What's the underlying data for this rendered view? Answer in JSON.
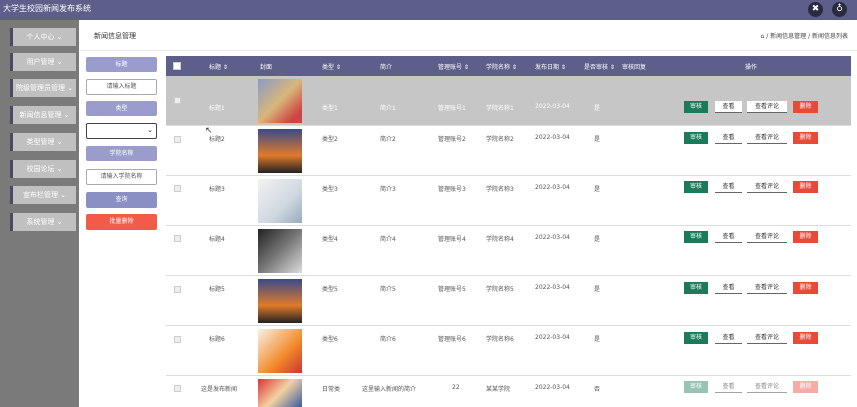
{
  "app": {
    "title": "大学生校园新闻发布系统"
  },
  "top_icons": [
    "expand-icon",
    "user-icon"
  ],
  "sidebar": {
    "items": [
      {
        "label": "个人中心"
      },
      {
        "label": "用户管理"
      },
      {
        "label": "院级管理员管理"
      },
      {
        "label": "新闻信息管理"
      },
      {
        "label": "类型管理"
      },
      {
        "label": "校园论坛"
      },
      {
        "label": "宣布栏管理"
      },
      {
        "label": "系统管理"
      }
    ]
  },
  "header": {
    "page_title": "新闻信息管理",
    "breadcrumb": "⌂ / 新闻信息管理 / 新闻信息列表"
  },
  "filter": {
    "title_label": "标题",
    "title_placeholder": "请输入标题",
    "type_label": "类型",
    "college_label": "学院名称",
    "college_placeholder": "请输入学院名称",
    "search_button": "查询",
    "batch_delete_button": "批量删除"
  },
  "table": {
    "headers": [
      "标题 ⇕",
      "封面",
      "类型 ⇕",
      "简介",
      "管理账号 ⇕",
      "学院名称 ⇕",
      "发布日期 ⇕",
      "是否审核 ⇕",
      "审核回复",
      "操作"
    ],
    "rows": [
      {
        "title": "标题1",
        "type": "类型1",
        "intro": "简介1",
        "account": "管理账号1",
        "college": "学院名称1",
        "date": "2022-03-04",
        "reviewed": "是"
      },
      {
        "title": "标题2",
        "type": "类型2",
        "intro": "简介2",
        "account": "管理账号2",
        "college": "学院名称2",
        "date": "2022-03-04",
        "reviewed": "是"
      },
      {
        "title": "标题3",
        "type": "类型3",
        "intro": "简介3",
        "account": "管理账号3",
        "college": "学院名称3",
        "date": "2022-03-04",
        "reviewed": "是"
      },
      {
        "title": "标题4",
        "type": "类型4",
        "intro": "简介4",
        "account": "管理账号4",
        "college": "学院名称4",
        "date": "2022-03-04",
        "reviewed": "是"
      },
      {
        "title": "标题5",
        "type": "类型5",
        "intro": "简介5",
        "account": "管理账号5",
        "college": "学院名称5",
        "date": "2022-03-04",
        "reviewed": "是"
      },
      {
        "title": "标题6",
        "type": "类型6",
        "intro": "简介6",
        "account": "管理账号6",
        "college": "学院名称6",
        "date": "2022-03-04",
        "reviewed": "是"
      },
      {
        "title": "这是发布新闻",
        "type": "日常类",
        "intro": "这里输入新闻的简介",
        "account": "22",
        "college": "某某学院",
        "date": "2022-03-04",
        "reviewed": "否"
      }
    ],
    "actions": {
      "audit": "审核",
      "view": "查看",
      "review": "查看评论",
      "delete": "删除"
    }
  },
  "colors": {
    "header_bg": "#5d5f8a",
    "sidebar_bg": "#7a7a7a",
    "filter_label": "#9a9dcc",
    "audit": "#1a7a5a",
    "delete": "#e84a3a"
  }
}
